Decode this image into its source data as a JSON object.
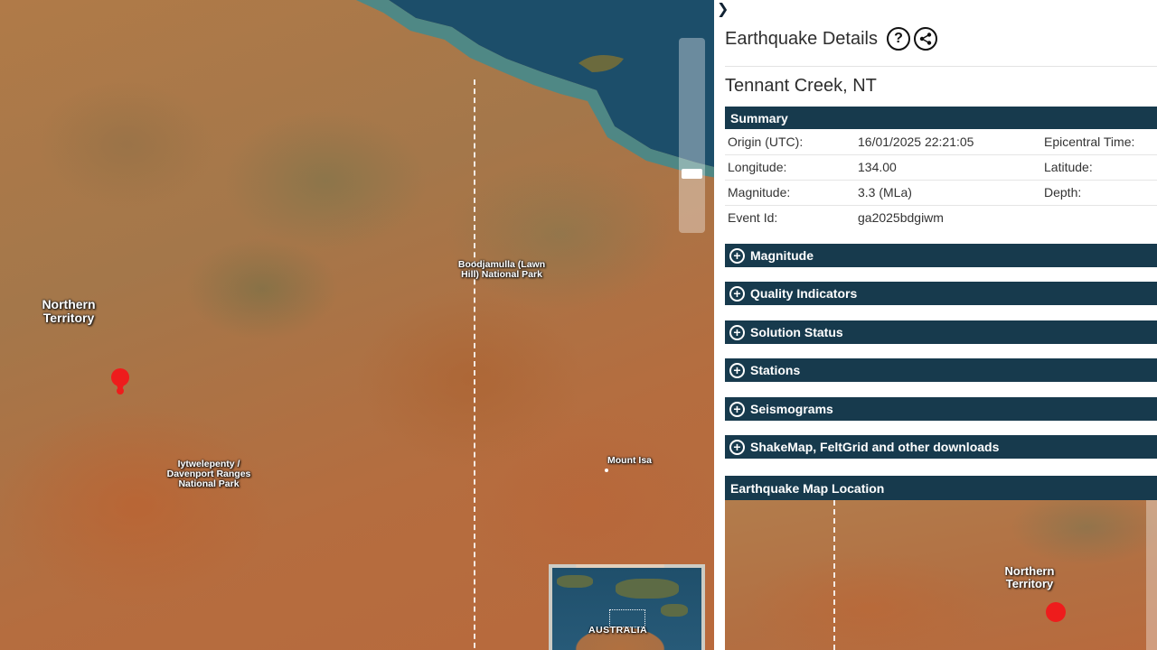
{
  "map": {
    "labels": {
      "northern_territory": "Northern Territory",
      "boodjamulla": "Boodjamulla (Lawn Hill) National Park",
      "iytwelepenty": "Iytwelepenty / Davenport Ranges National Park",
      "mount_isa": "Mount Isa"
    },
    "overview_label": "AUSTRALIA",
    "epicenter_color": "#ee1c1c"
  },
  "panel": {
    "collapse_icon": "chevron-right-icon",
    "title": "Earthquake Details",
    "help_icon": "question-circle-icon",
    "share_icon": "share-icon",
    "location": "Tennant Creek, NT",
    "summary": {
      "heading": "Summary",
      "rows": [
        {
          "label": "Origin (UTC):",
          "value": "16/01/2025 22:21:05",
          "label2": "Epicentral Time:"
        },
        {
          "label": "Longitude:",
          "value": "134.00",
          "label2": "Latitude:"
        },
        {
          "label": "Magnitude:",
          "value": "3.3 (MLa)",
          "label2": "Depth:"
        },
        {
          "label": "Event Id:",
          "value": "ga2025bdgiwm",
          "label2": ""
        }
      ]
    },
    "sections": [
      {
        "label": "Magnitude"
      },
      {
        "label": "Quality Indicators"
      },
      {
        "label": "Solution Status"
      },
      {
        "label": "Stations"
      },
      {
        "label": "Seismograms"
      },
      {
        "label": "ShakeMap, FeltGrid and other downloads"
      }
    ],
    "map_location": {
      "heading": "Earthquake Map Location",
      "label": "Northern Territory"
    },
    "colors": {
      "section_bar": "#173a4d",
      "text": "#333333"
    }
  }
}
